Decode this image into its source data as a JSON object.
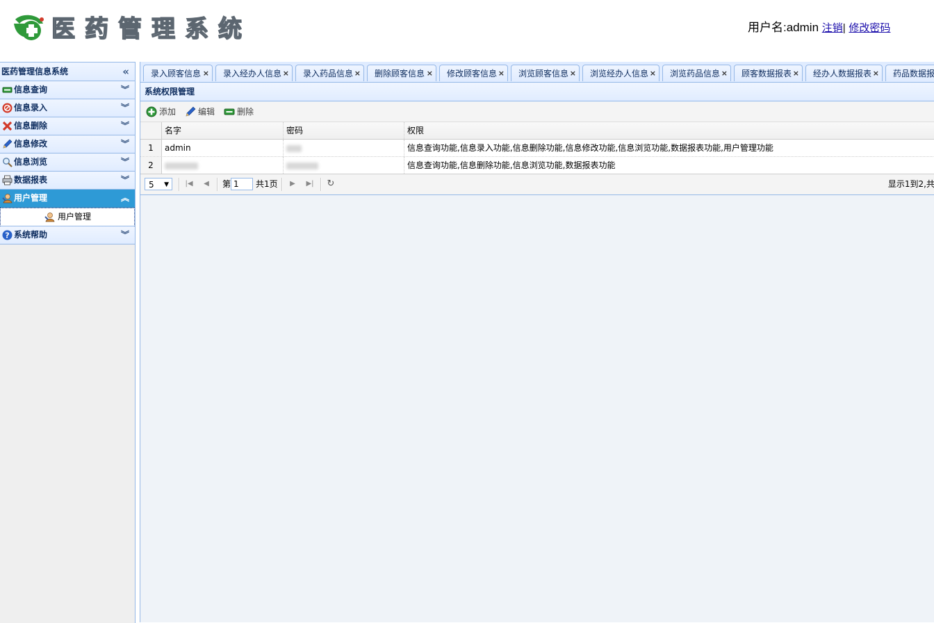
{
  "header": {
    "logo_text": "医药管理系统",
    "user_label": "用户名:admin",
    "logout_link": "注销",
    "separator": "|",
    "change_password_link": "修改密码"
  },
  "sidebar": {
    "title": "医药管理信息系统",
    "items": [
      {
        "label": "信息查询",
        "icon": "query-icon"
      },
      {
        "label": "信息录入",
        "icon": "entry-icon"
      },
      {
        "label": "信息删除",
        "icon": "delete-icon"
      },
      {
        "label": "信息修改",
        "icon": "edit-icon"
      },
      {
        "label": "信息浏览",
        "icon": "browse-icon"
      },
      {
        "label": "数据报表",
        "icon": "report-icon"
      },
      {
        "label": "用户管理",
        "icon": "user-manage-icon",
        "active": true
      },
      {
        "label": "系统帮助",
        "icon": "help-icon"
      }
    ],
    "sub_item": "用户管理"
  },
  "tabs": [
    "录入顾客信息",
    "录入经办人信息",
    "录入药品信息",
    "删除顾客信息",
    "修改顾客信息",
    "浏览顾客信息",
    "浏览经办人信息",
    "浏览药品信息",
    "顾客数据报表",
    "经办人数据报表",
    "药品数据报"
  ],
  "panel": {
    "title": "系统权限管理",
    "toolbar": {
      "add": "添加",
      "edit": "编辑",
      "delete": "删除"
    }
  },
  "grid": {
    "columns": [
      "名字",
      "密码",
      "权限"
    ],
    "rows": [
      {
        "num": "1",
        "name": "admin",
        "password": "",
        "permissions": "信息查询功能,信息录入功能,信息删除功能,信息修改功能,信息浏览功能,数据报表功能,用户管理功能"
      },
      {
        "num": "2",
        "name": "",
        "password": "",
        "permissions": "信息查询功能,信息删除功能,信息浏览功能,数据报表功能"
      }
    ]
  },
  "pager": {
    "page_size": "5",
    "page_prefix": "第",
    "page_value": "1",
    "page_total": "共1页",
    "info": "显示1到2,共"
  },
  "colors": {
    "accent": "#2e9ad6",
    "border": "#95b8e7",
    "panel_bg": "#e0ecff",
    "logo_green": "#2f9a3a",
    "logo_red": "#d23a2a"
  }
}
